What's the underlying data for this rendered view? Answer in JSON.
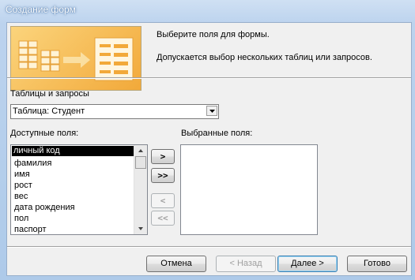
{
  "window": {
    "title": "Создание форм"
  },
  "intro": {
    "line1": "Выберите поля для формы.",
    "line2": "Допускается выбор нескольких таблиц или запросов."
  },
  "source": {
    "label": "Таблицы и запросы",
    "selected": "Таблица: Студент"
  },
  "available": {
    "label": "Доступные поля:",
    "items": [
      "личный код",
      "фамилия",
      "имя",
      "рост",
      "вес",
      "дата рождения",
      "пол",
      "паспорт"
    ],
    "selected_index": 0
  },
  "selected_fields": {
    "label": "Выбранные поля:",
    "items": []
  },
  "move_buttons": {
    "add_one": ">",
    "add_all": ">>",
    "remove_one": "<",
    "remove_all": "<<"
  },
  "footer": {
    "cancel": "Отмена",
    "back": "< Назад",
    "next": "Далее >",
    "finish": "Готово"
  },
  "colors": {
    "highlight": "#000000",
    "illustration": "#f2a93a"
  }
}
